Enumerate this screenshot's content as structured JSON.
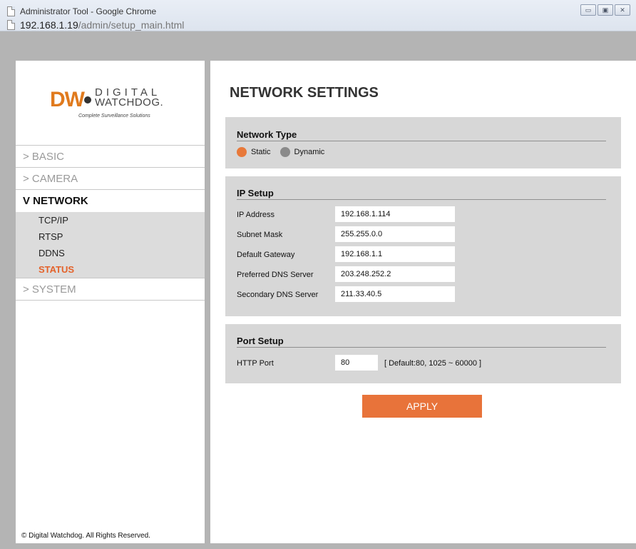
{
  "window": {
    "title": "Administrator Tool - Google Chrome",
    "url_host": "192.168.1.19",
    "url_path": "/admin/setup_main.html",
    "controls": {
      "minimize": "▭",
      "maximize": "▣",
      "close": "✕"
    }
  },
  "logo": {
    "mark": "DW",
    "line1": "DIGITAL",
    "line2": "WATCHDOG.",
    "tagline": "Complete Surveillance Solutions",
    "brand_color": "#e07a1d"
  },
  "sidebar": {
    "items": [
      {
        "label": "> BASIC"
      },
      {
        "label": "> CAMERA"
      },
      {
        "label": "V NETWORK"
      },
      {
        "label": "> SYSTEM"
      }
    ],
    "subitems": [
      {
        "label": "TCP/IP"
      },
      {
        "label": "RTSP"
      },
      {
        "label": "DDNS"
      },
      {
        "label": "STATUS"
      }
    ],
    "copyright": "© Digital Watchdog. All Rights Reserved."
  },
  "main": {
    "title": "NETWORK SETTINGS",
    "network_type": {
      "heading": "Network Type",
      "options": [
        {
          "label": "Static",
          "selected": true
        },
        {
          "label": "Dynamic",
          "selected": false
        }
      ]
    },
    "ip_setup": {
      "heading": "IP Setup",
      "fields": [
        {
          "label": "IP Address",
          "value": "192.168.1.114"
        },
        {
          "label": "Subnet Mask",
          "value": "255.255.0.0"
        },
        {
          "label": "Default Gateway",
          "value": "192.168.1.1"
        },
        {
          "label": "Preferred DNS Server",
          "value": "203.248.252.2"
        },
        {
          "label": "Secondary DNS Server",
          "value": "211.33.40.5"
        }
      ]
    },
    "port_setup": {
      "heading": "Port Setup",
      "http_label": "HTTP Port",
      "http_value": "80",
      "http_note": "[ Default:80, 1025 ~ 60000 ]"
    },
    "apply_label": "APPLY"
  },
  "colors": {
    "accent": "#e8733a",
    "active_nav": "#e4622a",
    "panel_gray": "#d7d7d7",
    "frame_gray": "#b4b4b4"
  }
}
